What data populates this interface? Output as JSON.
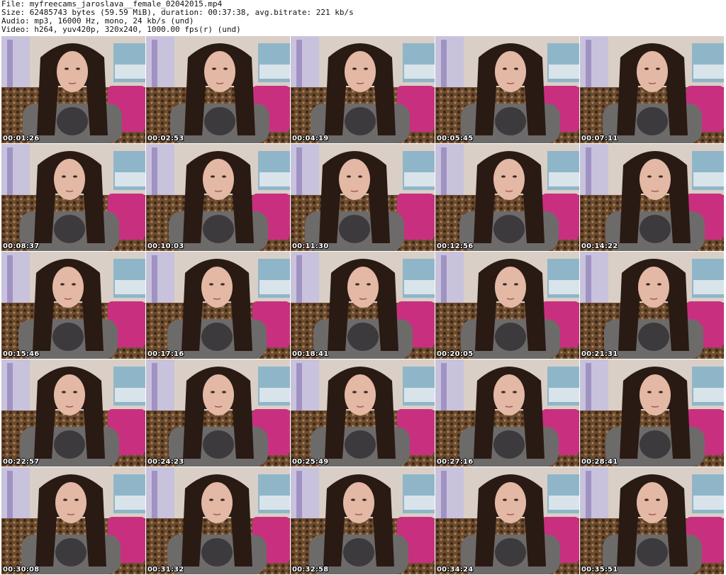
{
  "header": {
    "file_line": "File: myfreecams_jaroslava__female_02042015.mp4",
    "size_line": "Size: 62485743 bytes (59.59 MiB), duration: 00:37:38, avg.bitrate: 221 kb/s",
    "audio_line": "Audio: mp3, 16000 Hz, mono, 24 kb/s (und)",
    "video_line": "Video: h264, yuv420p, 320x240, 1000.00 fps(r) (und)"
  },
  "thumbnails": [
    {
      "timestamp": "00:01:26"
    },
    {
      "timestamp": "00:02:53"
    },
    {
      "timestamp": "00:04:19"
    },
    {
      "timestamp": "00:05:45"
    },
    {
      "timestamp": "00:07:11"
    },
    {
      "timestamp": "00:08:37"
    },
    {
      "timestamp": "00:10:03"
    },
    {
      "timestamp": "00:11:30"
    },
    {
      "timestamp": "00:12:56"
    },
    {
      "timestamp": "00:14:22"
    },
    {
      "timestamp": "00:15:46"
    },
    {
      "timestamp": "00:17:16"
    },
    {
      "timestamp": "00:18:41"
    },
    {
      "timestamp": "00:20:05"
    },
    {
      "timestamp": "00:21:31"
    },
    {
      "timestamp": "00:22:57"
    },
    {
      "timestamp": "00:24:23"
    },
    {
      "timestamp": "00:25:49"
    },
    {
      "timestamp": "00:27:16"
    },
    {
      "timestamp": "00:28:41"
    },
    {
      "timestamp": "00:30:08"
    },
    {
      "timestamp": "00:31:32"
    },
    {
      "timestamp": "00:32:58"
    },
    {
      "timestamp": "00:34:24"
    },
    {
      "timestamp": "00:35:51"
    }
  ],
  "colors": {
    "wall": "#d9cfc6",
    "lavender_poster": "#c9c2dc",
    "pillow": "#c8307f",
    "couch": "#6b4a2e",
    "hair": "#2a1a14",
    "skin": "#e3b8a4",
    "sweater": "#6d6a6a"
  }
}
